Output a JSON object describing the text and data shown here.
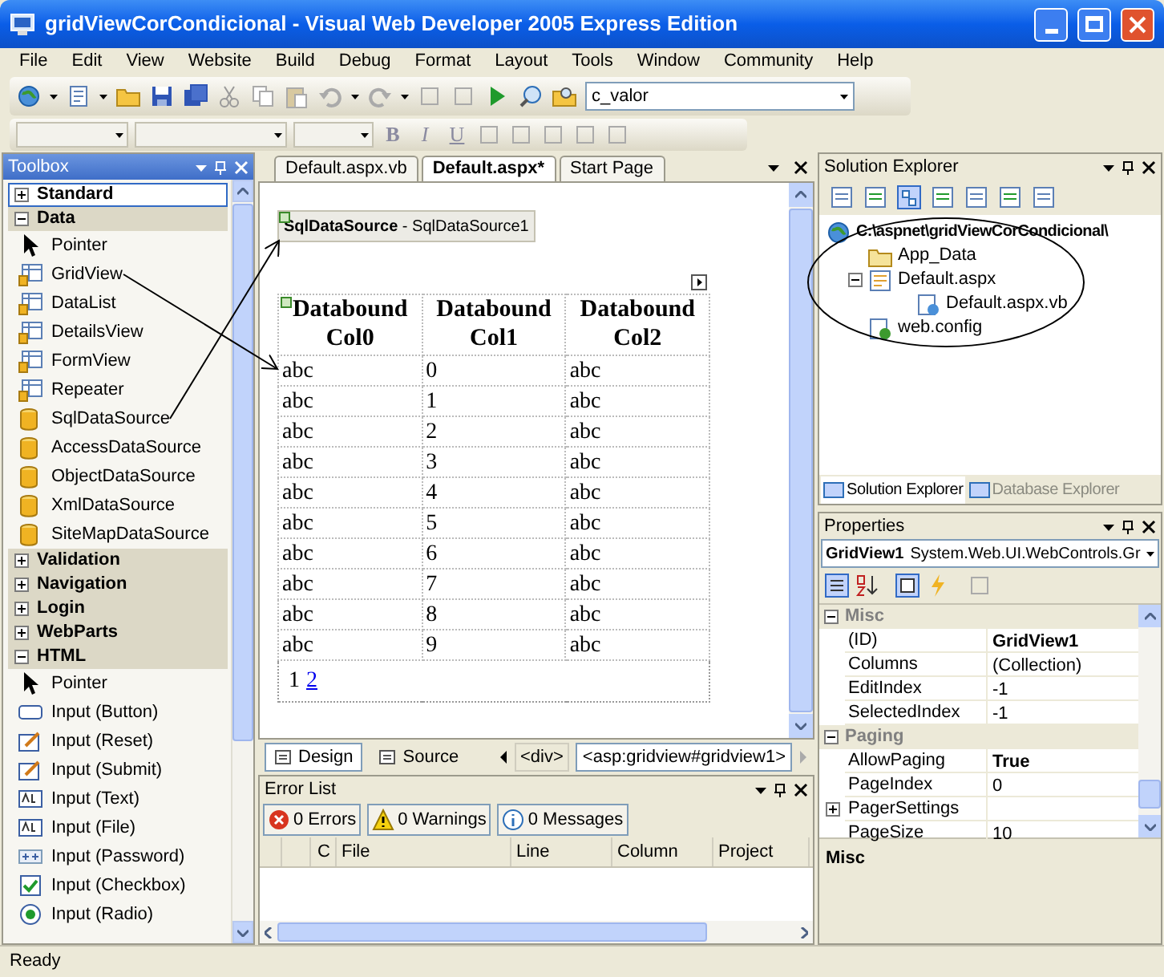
{
  "window": {
    "title": "gridViewCorCondicional - Visual Web Developer 2005 Express Edition"
  },
  "menu": [
    "File",
    "Edit",
    "View",
    "Website",
    "Build",
    "Debug",
    "Format",
    "Layout",
    "Tools",
    "Window",
    "Community",
    "Help"
  ],
  "toolbar": {
    "find_combo": "c_valor",
    "format_buttons": [
      "B",
      "I",
      "U"
    ]
  },
  "toolbox": {
    "title": "Toolbox",
    "groups": [
      {
        "label": "Standard",
        "expanded": false,
        "selected": true
      },
      {
        "label": "Data",
        "expanded": true,
        "selected": false,
        "items": [
          {
            "label": "Pointer",
            "kind": "pointer"
          },
          {
            "label": "GridView",
            "kind": "control"
          },
          {
            "label": "DataList",
            "kind": "control"
          },
          {
            "label": "DetailsView",
            "kind": "control"
          },
          {
            "label": "FormView",
            "kind": "control"
          },
          {
            "label": "Repeater",
            "kind": "control"
          },
          {
            "label": "SqlDataSource",
            "kind": "datasource"
          },
          {
            "label": "AccessDataSource",
            "kind": "datasource"
          },
          {
            "label": "ObjectDataSource",
            "kind": "datasource"
          },
          {
            "label": "XmlDataSource",
            "kind": "datasource"
          },
          {
            "label": "SiteMapDataSource",
            "kind": "datasource"
          }
        ]
      },
      {
        "label": "Validation",
        "expanded": false,
        "selected": false
      },
      {
        "label": "Navigation",
        "expanded": false,
        "selected": false
      },
      {
        "label": "Login",
        "expanded": false,
        "selected": false
      },
      {
        "label": "WebParts",
        "expanded": false,
        "selected": false
      },
      {
        "label": "HTML",
        "expanded": true,
        "selected": false,
        "items": [
          {
            "label": "Pointer",
            "kind": "pointer"
          },
          {
            "label": "Input (Button)",
            "kind": "button"
          },
          {
            "label": "Input (Reset)",
            "kind": "edit"
          },
          {
            "label": "Input (Submit)",
            "kind": "edit"
          },
          {
            "label": "Input (Text)",
            "kind": "text"
          },
          {
            "label": "Input (File)",
            "kind": "text"
          },
          {
            "label": "Input (Password)",
            "kind": "password"
          },
          {
            "label": "Input (Checkbox)",
            "kind": "checkbox"
          },
          {
            "label": "Input (Radio)",
            "kind": "radio"
          }
        ]
      }
    ]
  },
  "editor": {
    "tabs": [
      {
        "label": "Default.aspx.vb",
        "selected": false
      },
      {
        "label": "Default.aspx*",
        "selected": true
      },
      {
        "label": "Start Page",
        "selected": false
      }
    ],
    "datasource": "**SqlDataSource** - SqlDataSource1",
    "grid": {
      "columns": [
        "Databound Col0",
        "Databound Col1",
        "Databound Col2"
      ],
      "rows": [
        [
          "abc",
          "0",
          "abc"
        ],
        [
          "abc",
          "1",
          "abc"
        ],
        [
          "abc",
          "2",
          "abc"
        ],
        [
          "abc",
          "3",
          "abc"
        ],
        [
          "abc",
          "4",
          "abc"
        ],
        [
          "abc",
          "5",
          "abc"
        ],
        [
          "abc",
          "6",
          "abc"
        ],
        [
          "abc",
          "7",
          "abc"
        ],
        [
          "abc",
          "8",
          "abc"
        ],
        [
          "abc",
          "9",
          "abc"
        ]
      ],
      "pager": [
        {
          "label": "1",
          "selected": true
        },
        {
          "label": "2",
          "selected": false
        }
      ]
    },
    "view_tabs": [
      {
        "label": "Design",
        "selected": true
      },
      {
        "label": "Source",
        "selected": false
      }
    ],
    "breadcrumbs": [
      {
        "label": "<div>",
        "selected": false
      },
      {
        "label": "<asp:gridview#gridview1>",
        "selected": true
      }
    ]
  },
  "error_list": {
    "title": "Error List",
    "filters": [
      {
        "kind": "error",
        "label": "0 Errors",
        "on": true
      },
      {
        "kind": "warning",
        "label": "0 Warnings",
        "on": true
      },
      {
        "kind": "message",
        "label": "0 Messages",
        "on": true
      }
    ],
    "columns": [
      "C",
      "File",
      "Line",
      "Column",
      "Project"
    ]
  },
  "solution_explorer": {
    "title": "Solution Explorer",
    "tree": [
      {
        "label": "C:\\aspnet\\gridViewCorCondicional\\",
        "kind": "web",
        "children": [
          {
            "label": "App_Data",
            "kind": "folder"
          },
          {
            "label": "Default.aspx",
            "kind": "page",
            "expanded": true,
            "children": [
              {
                "label": "Default.aspx.vb",
                "kind": "code"
              }
            ]
          },
          {
            "label": "web.config",
            "kind": "config"
          }
        ]
      }
    ],
    "tabs": [
      {
        "label": "Solution Explorer",
        "selected": true
      },
      {
        "label": "Database Explorer",
        "selected": false
      }
    ]
  },
  "properties": {
    "title": "Properties",
    "object": "GridView1",
    "object_type": "System.Web.UI.WebControls.Gr",
    "categories": [
      {
        "label": "Misc",
        "expanded": true,
        "rows": [
          {
            "name": "(ID)",
            "value": "GridView1",
            "bold": true
          },
          {
            "name": "Columns",
            "value": "(Collection)",
            "bold": false
          },
          {
            "name": "EditIndex",
            "value": "-1",
            "bold": false
          },
          {
            "name": "SelectedIndex",
            "value": "-1",
            "bold": false
          }
        ]
      },
      {
        "label": "Paging",
        "expanded": true,
        "rows": [
          {
            "name": "AllowPaging",
            "value": "True",
            "bold": true
          },
          {
            "name": "PageIndex",
            "value": "0",
            "bold": false
          },
          {
            "name": "PagerSettings",
            "expanded": false
          },
          {
            "name": "PageSize",
            "value": "10",
            "bold": false
          }
        ]
      }
    ],
    "description": "Misc"
  },
  "status_bar": "Ready"
}
